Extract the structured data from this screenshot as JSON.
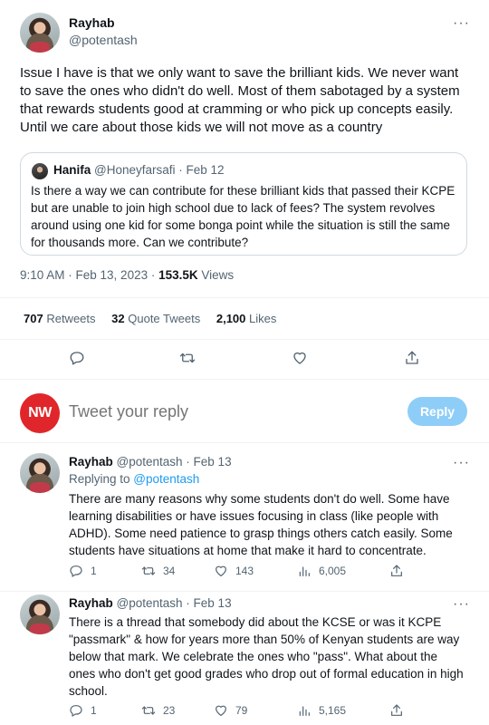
{
  "main_tweet": {
    "author_name": "Rayhab",
    "author_handle": "@potentash",
    "text": "Issue I have is that we only want to save the brilliant kids. We never want to save the ones who didn't do well. Most of them sabotaged by a system that rewards students good at cramming or who pick up concepts easily. Until we care about those kids we will not move as a country",
    "quote": {
      "author_name": "Hanifa",
      "meta": "@Honeyfarsafi · Feb 12",
      "text": "Is there a way we can contribute for these brilliant kids that passed their KCPE but are unable to join high school due to lack of fees? The system revolves around using one kid for some bonga point while the situation is still the same for thousands more. Can we contribute?"
    },
    "timestamp": "9:10 AM · Feb 13, 2023 · ",
    "views_count": "153.5K",
    "views_label": " Views",
    "stats": {
      "retweets_count": "707",
      "retweets_label": "Retweets",
      "quotes_count": "32",
      "quotes_label": "Quote Tweets",
      "likes_count": "2,100",
      "likes_label": "Likes"
    }
  },
  "compose": {
    "avatar_text": "NW",
    "placeholder": "Tweet your reply",
    "button_label": "Reply"
  },
  "replies": [
    {
      "author_name": "Rayhab",
      "meta": "@potentash · Feb 13",
      "replying_prefix": "Replying to ",
      "replying_handle": "@potentash",
      "text": "There are many reasons why some students don't do well. Some have learning disabilities or have issues focusing in class (like people with ADHD). Some need patience to grasp things others catch easily. Some students have situations at home that make it hard to concentrate.",
      "replies": "1",
      "retweets": "34",
      "likes": "143",
      "views": "6,005"
    },
    {
      "author_name": "Rayhab",
      "meta": "@potentash · Feb 13",
      "text": "There is a thread that somebody did about the KCSE or was it KCPE \"passmark\" & how for years more than 50% of Kenyan students are way below that mark. We celebrate the ones who \"pass\". What about the ones who don't get good grades who drop out of formal education in high school.",
      "replies": "1",
      "retweets": "23",
      "likes": "79",
      "views": "5,165"
    }
  ],
  "icons": {
    "more": "more-icon",
    "reply": "reply-icon",
    "retweet": "retweet-icon",
    "like": "like-icon",
    "share": "share-icon",
    "views": "views-icon"
  }
}
